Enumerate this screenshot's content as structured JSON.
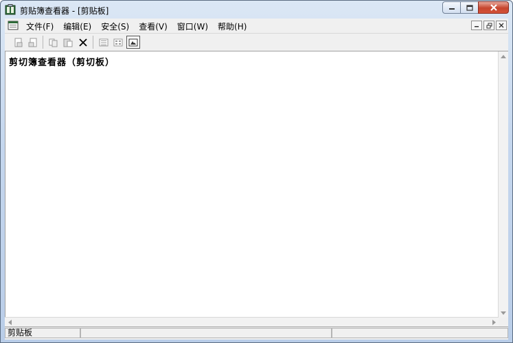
{
  "window": {
    "title": "剪贴簿查看器 - [剪贴板]"
  },
  "menu": {
    "items": [
      "文件(F)",
      "编辑(E)",
      "安全(S)",
      "查看(V)",
      "窗口(W)",
      "帮助(H)"
    ]
  },
  "toolbar": {
    "buttons": [
      "paste-to-page-icon",
      "copy-to-clipboard-icon",
      "copy-icon",
      "paste-icon",
      "delete-icon",
      "table-of-contents-icon",
      "thumbnails-icon",
      "full-page-icon"
    ],
    "pressed": "full-page-icon"
  },
  "content": {
    "text": "剪切簿查看器（剪切板）"
  },
  "statusbar": {
    "text": "剪贴板"
  },
  "colors": {
    "frame": "#c5d7ee",
    "close_button": "#c6452e",
    "content_bg": "#ffffff"
  }
}
